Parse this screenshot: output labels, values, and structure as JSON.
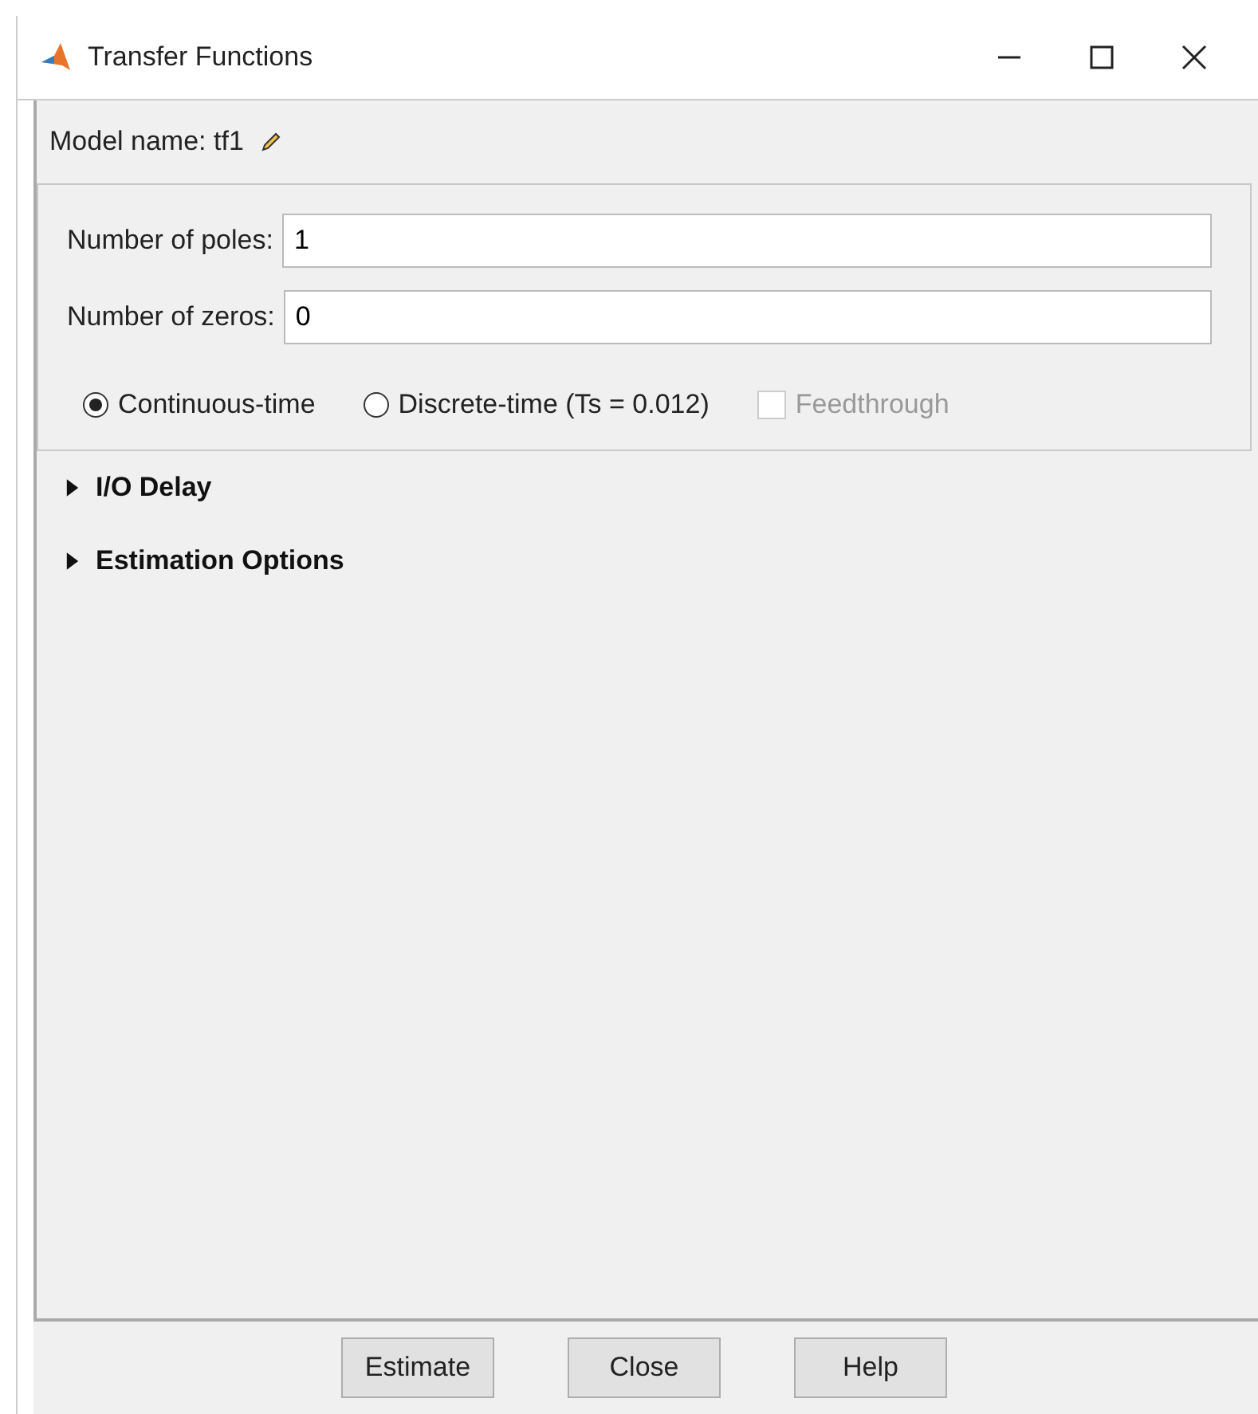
{
  "window": {
    "title": "Transfer Functions"
  },
  "model_name": {
    "label": "Model name: tf1"
  },
  "fields": [
    {
      "label": "Number of poles:",
      "value": "1"
    },
    {
      "label": "Number of zeros:",
      "value": "0"
    }
  ],
  "options": [
    {
      "kind": "radio",
      "label": "Continuous-time",
      "selected": true,
      "disabled": false
    },
    {
      "kind": "radio",
      "label": "Discrete-time (Ts = 0.012)",
      "selected": false,
      "disabled": false
    },
    {
      "kind": "checkbox",
      "label": "Feedthrough",
      "checked": false,
      "disabled": true
    }
  ],
  "sections": [
    {
      "label": "I/O Delay",
      "expanded": false
    },
    {
      "label": "Estimation Options",
      "expanded": false
    }
  ],
  "buttons": [
    "Estimate",
    "Close",
    "Help"
  ]
}
